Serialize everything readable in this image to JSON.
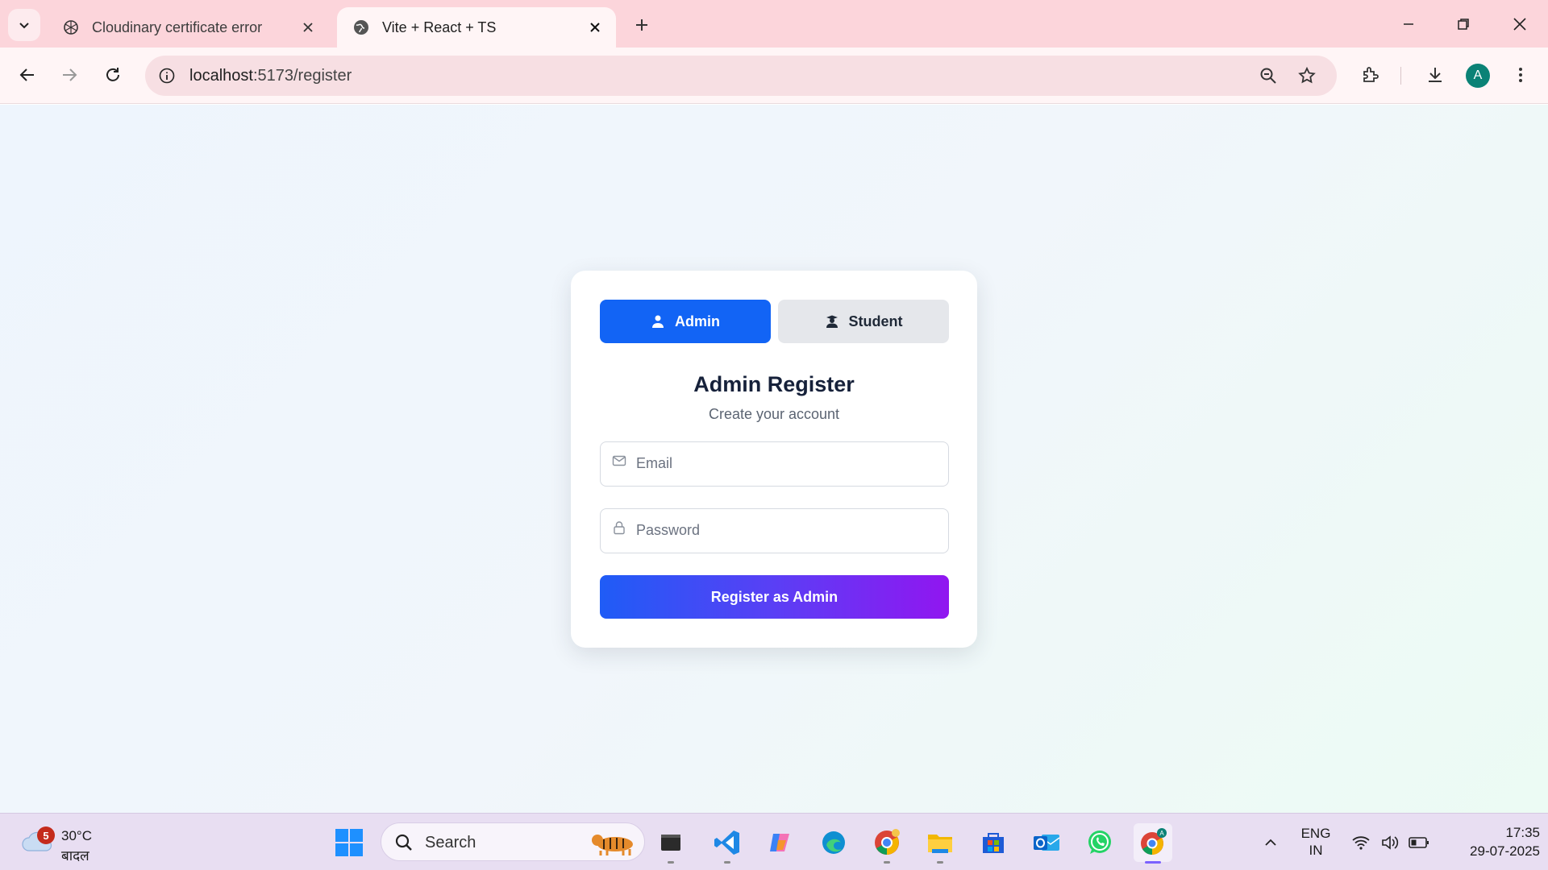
{
  "browser": {
    "tabs": [
      {
        "title": "Cloudinary certificate error",
        "active": false
      },
      {
        "title": "Vite + React + TS",
        "active": true
      }
    ],
    "url_host": "localhost",
    "url_path": ":5173/register",
    "profile_initial": "A"
  },
  "page": {
    "roles": {
      "admin": "Admin",
      "student": "Student",
      "selected": "Admin"
    },
    "title": "Admin Register",
    "subtitle": "Create your account",
    "email_placeholder": "Email",
    "email_value": "",
    "password_placeholder": "Password",
    "password_value": "",
    "submit_label": "Register as Admin",
    "colors": {
      "accent": "#1264f5",
      "gradient_start": "#1f5cf6",
      "gradient_end": "#9116f0"
    }
  },
  "taskbar": {
    "weather_temp": "30°C",
    "weather_condition": "बादल",
    "weather_badge": "5",
    "search_placeholder": "Search",
    "lang_line1": "ENG",
    "lang_line2": "IN",
    "time": "17:35",
    "date": "29-07-2025",
    "apps": [
      "start-icon",
      "file-explorer-terminal-icon",
      "vscode-icon",
      "copilot-icon",
      "edge-icon",
      "chrome-icon",
      "file-explorer-icon",
      "microsoft-store-icon",
      "outlook-icon",
      "whatsapp-icon",
      "chrome-profile-icon"
    ]
  }
}
